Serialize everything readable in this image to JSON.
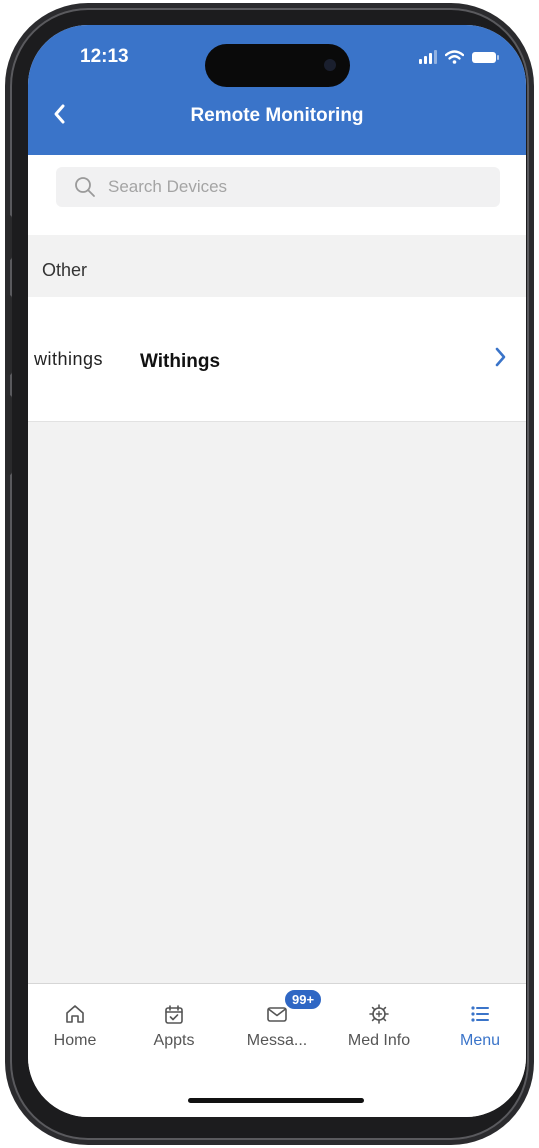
{
  "status_bar": {
    "time": "12:13"
  },
  "header": {
    "back_icon": "chevron-left-icon",
    "title": "Remote Monitoring"
  },
  "search": {
    "placeholder": "Search Devices",
    "icon": "search-icon"
  },
  "section": {
    "label": "Other"
  },
  "devices": [
    {
      "logo_text": "withings",
      "label": "Withings",
      "icon": "chevron-right-icon"
    }
  ],
  "tabbar": {
    "tabs": [
      {
        "label": "Home",
        "icon": "home-icon"
      },
      {
        "label": "Appts",
        "icon": "calendar-check-icon"
      },
      {
        "label": "Messa...",
        "icon": "mail-icon",
        "badge": "99+"
      },
      {
        "label": "Med Info",
        "icon": "medical-gear-icon"
      },
      {
        "label": "Menu",
        "icon": "list-icon",
        "active": true
      }
    ]
  },
  "colors": {
    "accent": "#3a74c9",
    "badge": "#2f67c4",
    "background": "#f2f2f2"
  }
}
